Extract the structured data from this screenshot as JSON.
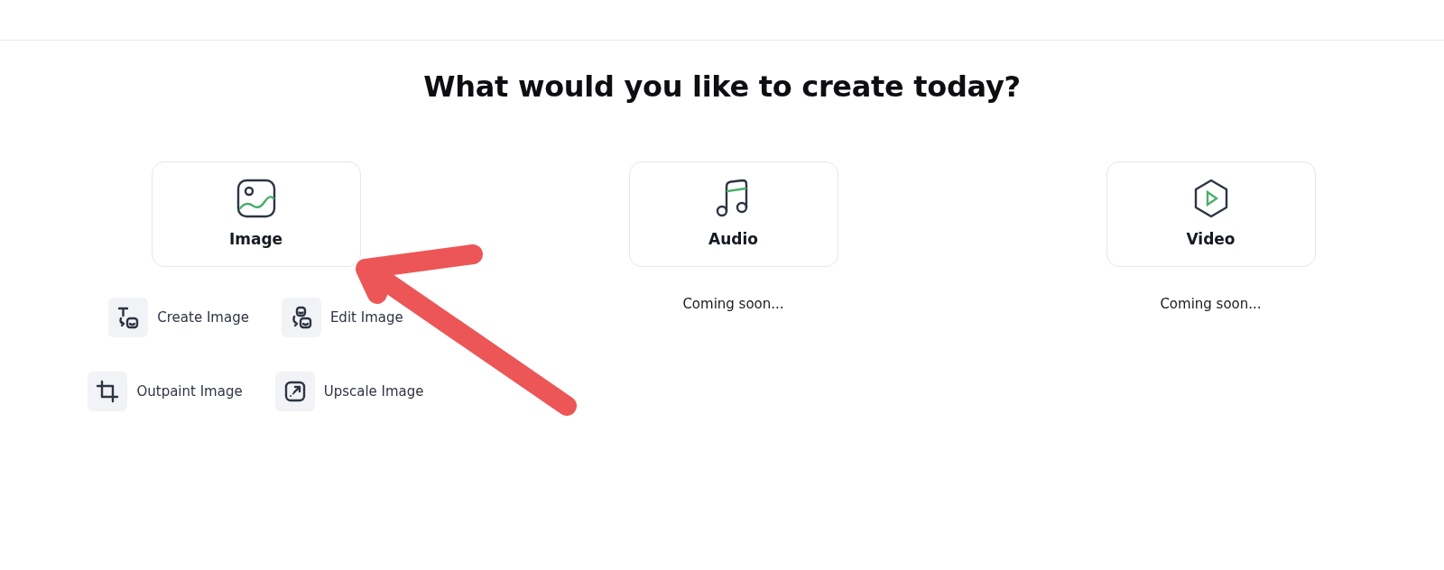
{
  "heading": "What would you like to create today?",
  "categories": [
    {
      "kind": "image",
      "label": "Image",
      "options": [
        {
          "kind": "create",
          "label": "Create Image"
        },
        {
          "kind": "edit",
          "label": "Edit Image"
        },
        {
          "kind": "outpaint",
          "label": "Outpaint Image"
        },
        {
          "kind": "upscale",
          "label": "Upscale Image"
        }
      ]
    },
    {
      "kind": "audio",
      "label": "Audio",
      "note": "Coming soon..."
    },
    {
      "kind": "video",
      "label": "Video",
      "note": "Coming soon..."
    }
  ]
}
